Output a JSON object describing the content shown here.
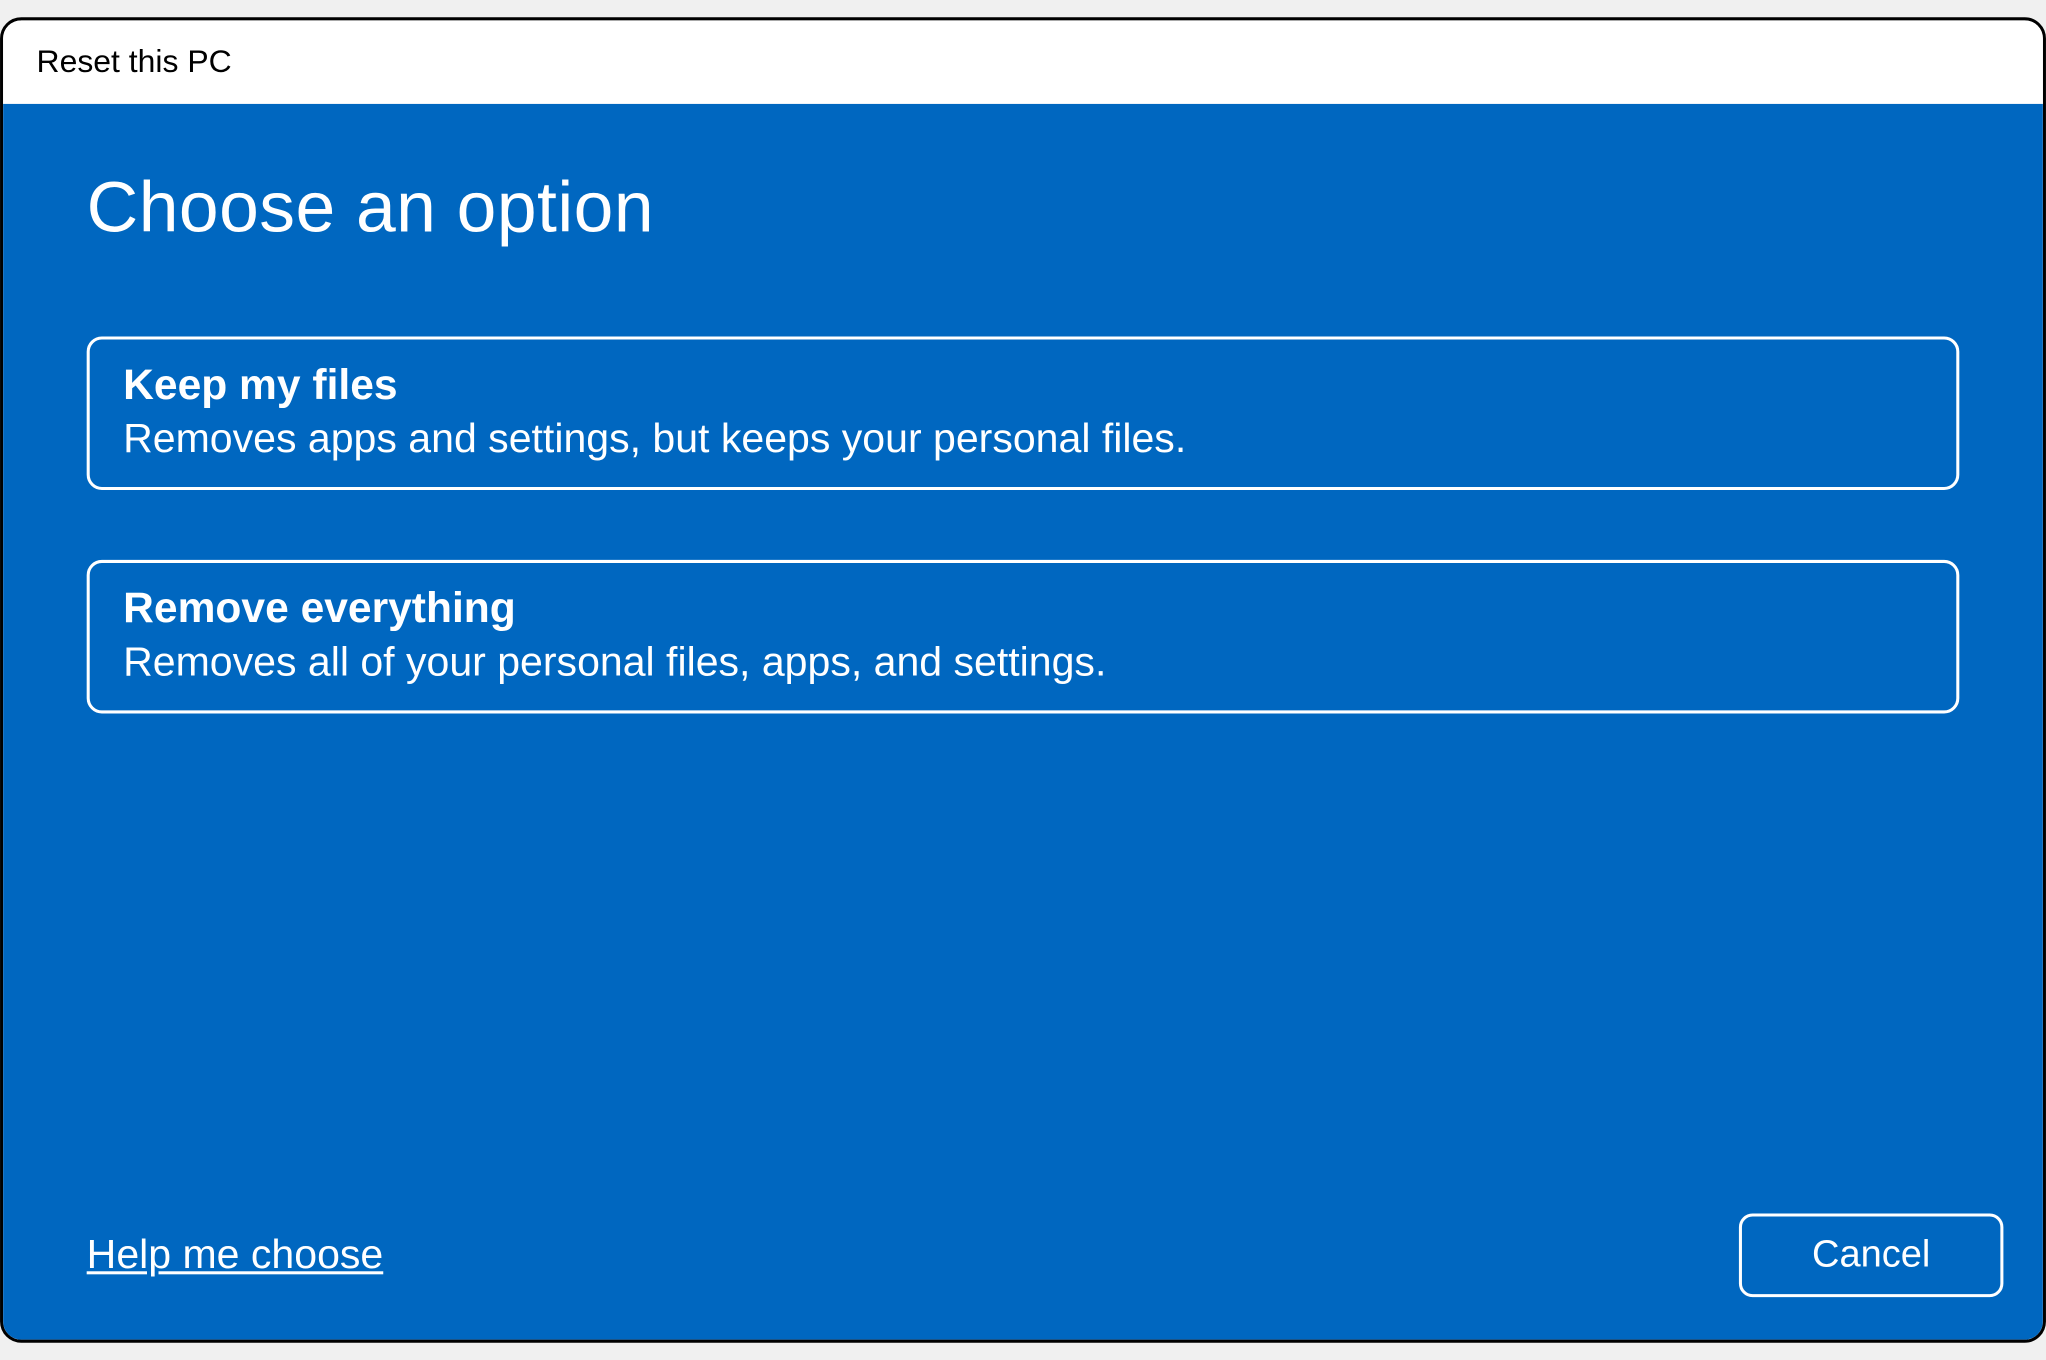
{
  "titlebar": {
    "title": "Reset this PC"
  },
  "main": {
    "heading": "Choose an option",
    "options": [
      {
        "title": "Keep my files",
        "description": "Removes apps and settings, but keeps your personal files."
      },
      {
        "title": "Remove everything",
        "description": "Removes all of your personal files, apps, and settings."
      }
    ],
    "help_link": "Help me choose",
    "cancel_label": "Cancel"
  },
  "colors": {
    "accent": "#0067c0",
    "text_light": "#ffffff",
    "text_dark": "#000000"
  }
}
